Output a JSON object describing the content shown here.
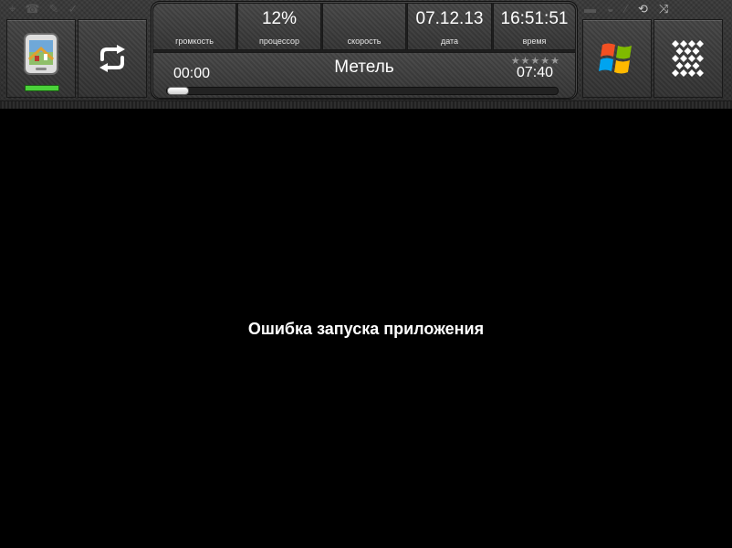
{
  "status_left": [
    "⌖",
    "☎",
    "✎",
    "✓"
  ],
  "status_right": [
    "▬",
    "◒",
    "⁄",
    "⟲",
    "⤨"
  ],
  "info": {
    "volume": {
      "value": "",
      "label": "громкость"
    },
    "cpu": {
      "value": "12%",
      "label": "процессор"
    },
    "speed": {
      "value": "",
      "label": "скорость"
    },
    "date": {
      "value": "07.12.13",
      "label": "дата"
    },
    "time": {
      "value": "16:51:51",
      "label": "время"
    }
  },
  "player": {
    "position": "00:00",
    "title": "Метель",
    "duration": "07:40",
    "rating": "★★★★★",
    "progress": 0.0
  },
  "main": {
    "error_message": "Ошибка запуска приложения"
  },
  "icons": {
    "nav_app": "navigator-app-icon",
    "refresh": "refresh-icon",
    "windows": "windows-logo-icon",
    "menu": "diamond-grid-menu-icon"
  },
  "colors": {
    "background": "#000000",
    "panel": "#3a3a3a",
    "indicator_green": "#4bd23a"
  }
}
